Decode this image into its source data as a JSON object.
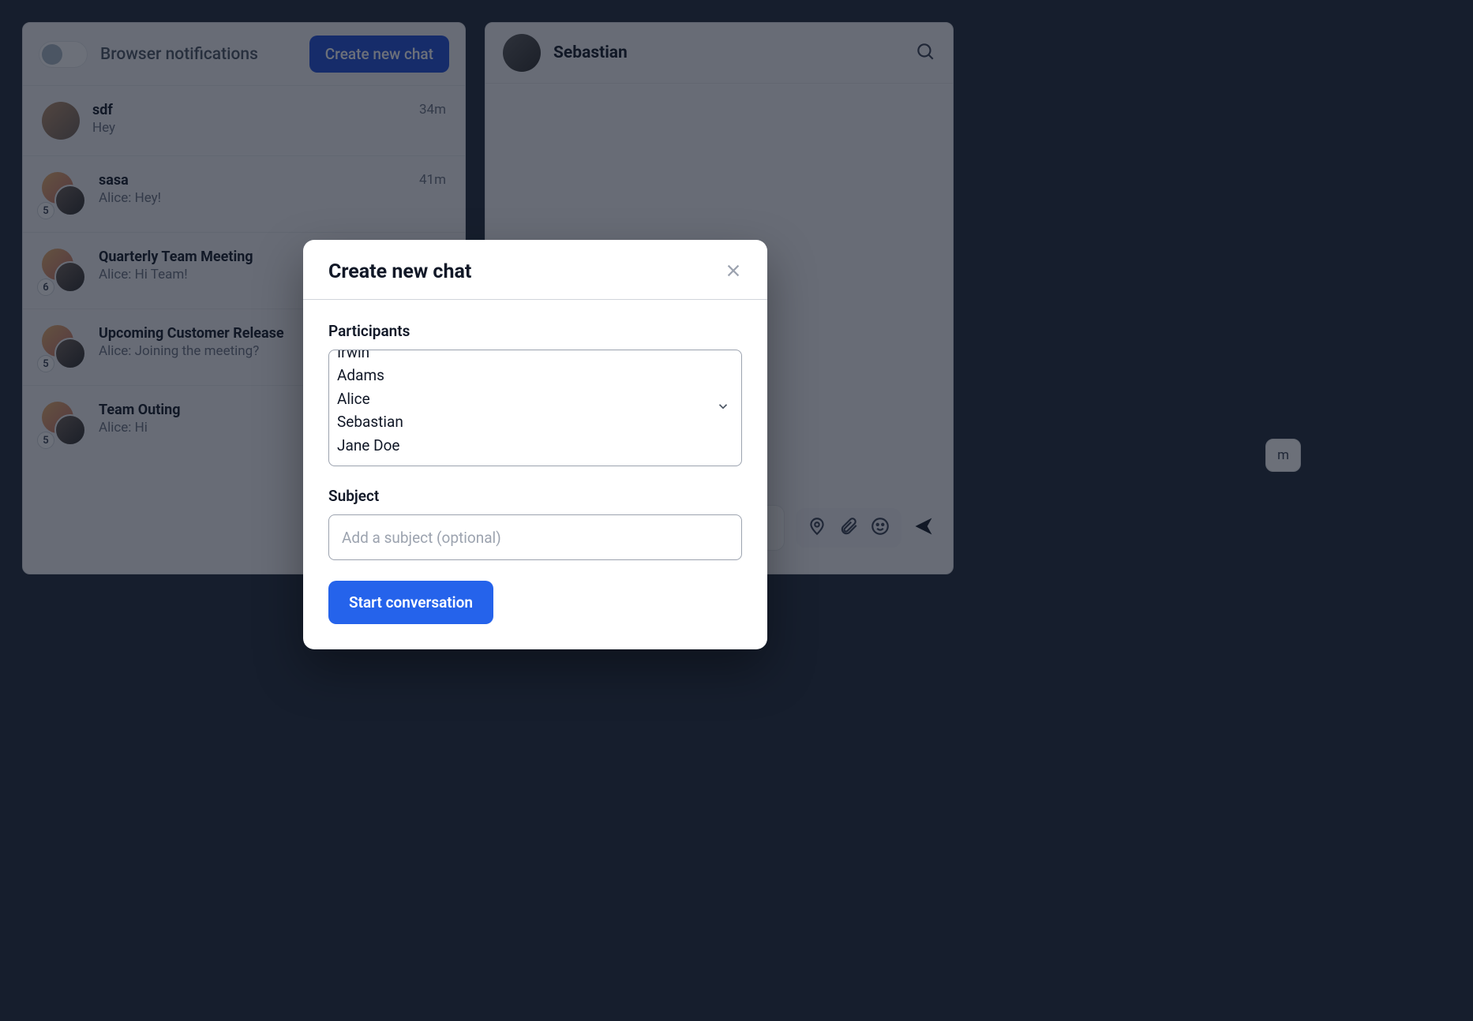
{
  "sidebar": {
    "toggle_label": "Browser notifications",
    "create_button": "Create new chat",
    "chats": [
      {
        "title": "sdf",
        "subtitle": "Hey",
        "time": "34m",
        "badge": ""
      },
      {
        "title": "sasa",
        "subtitle": "Alice: Hey!",
        "time": "41m",
        "badge": "5"
      },
      {
        "title": "Quarterly Team Meeting",
        "subtitle": "Alice: Hi Team!",
        "time": "",
        "badge": "6"
      },
      {
        "title": "Upcoming Customer Release",
        "subtitle": "Alice: Joining the meeting?",
        "time": "",
        "badge": "5"
      },
      {
        "title": "Team Outing",
        "subtitle": "Alice: Hi",
        "time": "",
        "badge": "5"
      }
    ]
  },
  "main": {
    "header_name": "Sebastian",
    "badge_text": "m"
  },
  "modal": {
    "title": "Create new chat",
    "participants_label": "Participants",
    "participants": [
      "Irwin",
      "Adams",
      "Alice",
      "Sebastian",
      "Jane Doe"
    ],
    "subject_label": "Subject",
    "subject_placeholder": "Add a subject (optional)",
    "start_button": "Start conversation"
  }
}
